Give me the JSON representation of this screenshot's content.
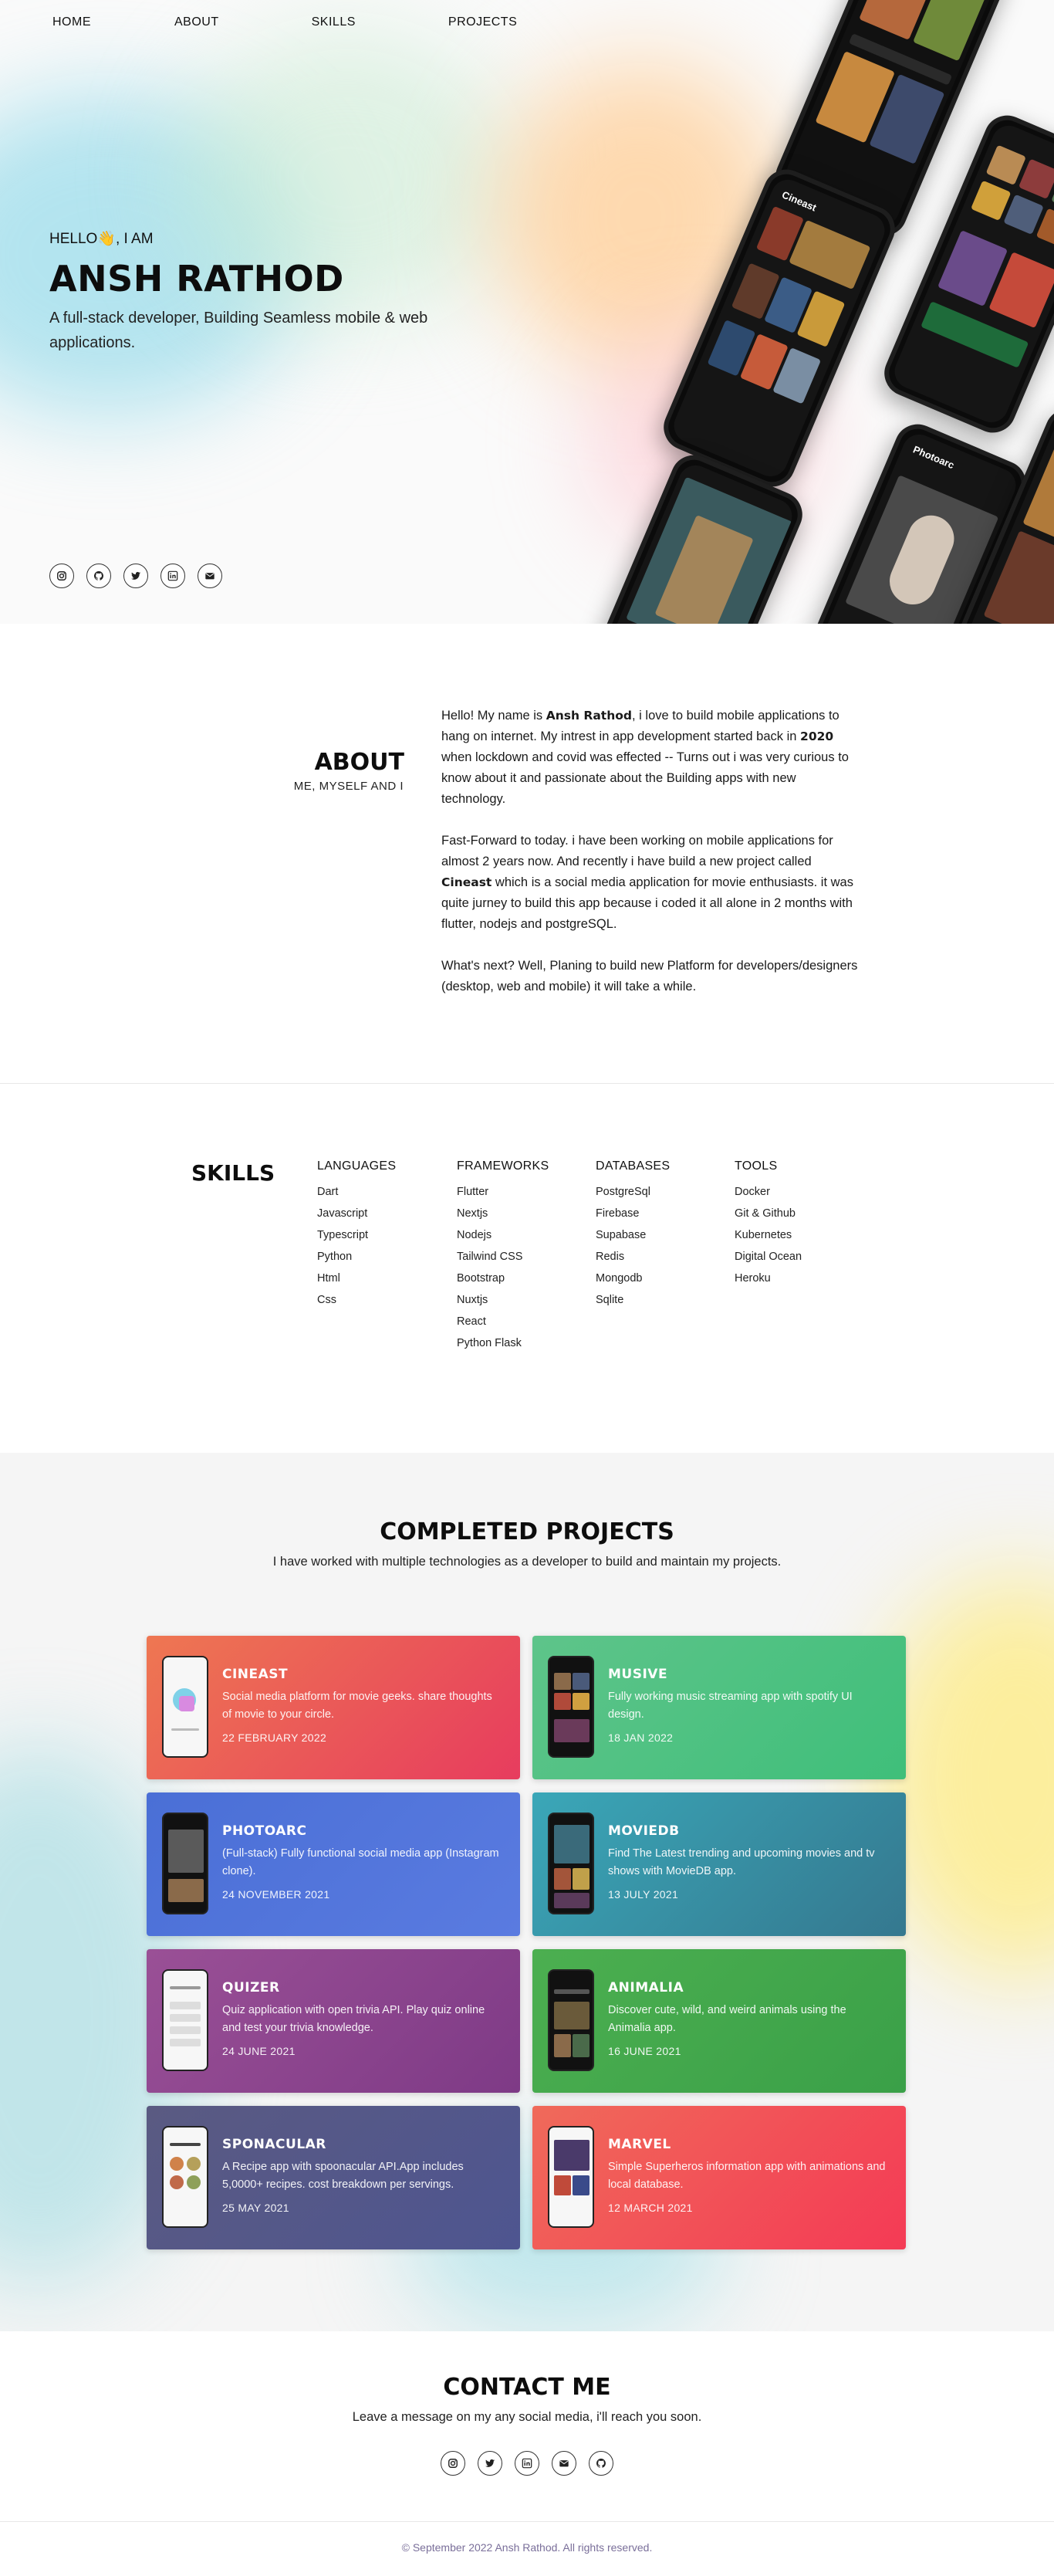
{
  "nav": {
    "items": [
      {
        "label": "HOME"
      },
      {
        "label": "ABOUT"
      },
      {
        "label": "SKILLS"
      },
      {
        "label": "PROJECTS"
      }
    ]
  },
  "hero": {
    "greeting": "HELLO👋, I AM",
    "name": "ANSH RATHOD",
    "tagline": "A full-stack developer, Building Seamless mobile & web applications.",
    "socials": [
      {
        "icon": "instagram-icon"
      },
      {
        "icon": "github-icon"
      },
      {
        "icon": "twitter-icon"
      },
      {
        "icon": "linkedin-icon"
      },
      {
        "icon": "mail-icon"
      }
    ],
    "phone_labels": [
      "Cineast",
      "Photoarc"
    ]
  },
  "about": {
    "title": "ABOUT",
    "subtitle": "ME, MYSELF AND I",
    "p1_a": "Hello! My name is ",
    "p1_name": "Ansh Rathod",
    "p1_b": ", i love to build mobile applications to hang on internet. My intrest in app development started back in ",
    "p1_year": "2020",
    "p1_c": " when lockdown and covid was effected -- Turns out i was very curious to know about it and passionate about the Building apps with new technology.",
    "p2_a": "Fast-Forward to today. i have been working on mobile applications for almost 2 years now. And recently i have build a new project called ",
    "p2_project": "Cineast",
    "p2_b": " which is a social media application for movie enthusiasts. it was quite jurney to build this app because i coded it all alone in 2 months with flutter, nodejs and postgreSQL.",
    "p3": "What's next? Well, Planing to build new Platform for developers/designers (desktop, web and mobile) it will take a while."
  },
  "skills": {
    "title": "SKILLS",
    "columns": [
      {
        "heading": "LANGUAGES",
        "items": [
          "Dart",
          "Javascript",
          "Typescript",
          "Python",
          "Html",
          "Css"
        ]
      },
      {
        "heading": "FRAMEWORKS",
        "items": [
          "Flutter",
          "Nextjs",
          "Nodejs",
          "Tailwind CSS",
          "Bootstrap",
          "Nuxtjs",
          "React",
          "Python Flask"
        ]
      },
      {
        "heading": "DATABASES",
        "items": [
          "PostgreSql",
          "Firebase",
          "Supabase",
          "Redis",
          "Mongodb",
          "Sqlite"
        ]
      },
      {
        "heading": "TOOLS",
        "items": [
          "Docker",
          "Git & Github",
          "Kubernetes",
          "Digital Ocean",
          "Heroku"
        ]
      }
    ]
  },
  "projects": {
    "title": "COMPLETED PROJECTS",
    "subtitle": "I have worked with multiple technologies as a developer to build and maintain my projects.",
    "cards": [
      {
        "title": "CINEAST",
        "desc": "Social media platform for movie geeks. share thoughts of movie to your circle.",
        "date": "22 FEBRUARY 2022",
        "colors": [
          "#ee7752",
          "#e73c5e"
        ]
      },
      {
        "title": "MUSIVE",
        "desc": "Fully working music streaming app with spotify UI design.",
        "date": "18 JAN 2022",
        "colors": [
          "#5ec48a",
          "#3fbf7a"
        ]
      },
      {
        "title": "PHOTOARC",
        "desc": "(Full-stack) Fully functional social media app (Instagram clone).",
        "date": "24 NOVEMBER 2021",
        "colors": [
          "#4a6fd6",
          "#5a7be0"
        ]
      },
      {
        "title": "MOVIEDB",
        "desc": "Find The Latest trending and upcoming movies and tv shows with MovieDB app.",
        "date": "13 JULY 2021",
        "colors": [
          "#3aa7b8",
          "#35788f"
        ]
      },
      {
        "title": "QUIZER",
        "desc": "Quiz application with open trivia API. Play quiz online and test your trivia knowledge.",
        "date": "24 JUNE 2021",
        "colors": [
          "#9a5096",
          "#7e3a86"
        ]
      },
      {
        "title": "ANIMALIA",
        "desc": "Discover cute, wild, and weird animals using the Animalia app.",
        "date": "16 JUNE 2021",
        "colors": [
          "#4caf50",
          "#3aa048"
        ]
      },
      {
        "title": "SPONACULAR",
        "desc": "A Recipe app with spoonacular API.App includes 5,0000+ recipes. cost breakdown per servings.",
        "date": "25 MAY 2021",
        "colors": [
          "#5a5a82",
          "#4e5590"
        ]
      },
      {
        "title": "MARVEL",
        "desc": "Simple Superheros information app with animations and local database.",
        "date": "12 MARCH 2021",
        "colors": [
          "#f06a5a",
          "#f43a55"
        ]
      }
    ]
  },
  "contact": {
    "title": "CONTACT ME",
    "subtitle": "Leave a message on my any social media, i'll reach you soon.",
    "socials": [
      {
        "icon": "instagram-icon"
      },
      {
        "icon": "twitter-icon"
      },
      {
        "icon": "linkedin-icon"
      },
      {
        "icon": "mail-icon"
      },
      {
        "icon": "github-icon"
      }
    ]
  },
  "footer": {
    "text": "© September 2022 Ansh Rathod. All rights reserved."
  }
}
